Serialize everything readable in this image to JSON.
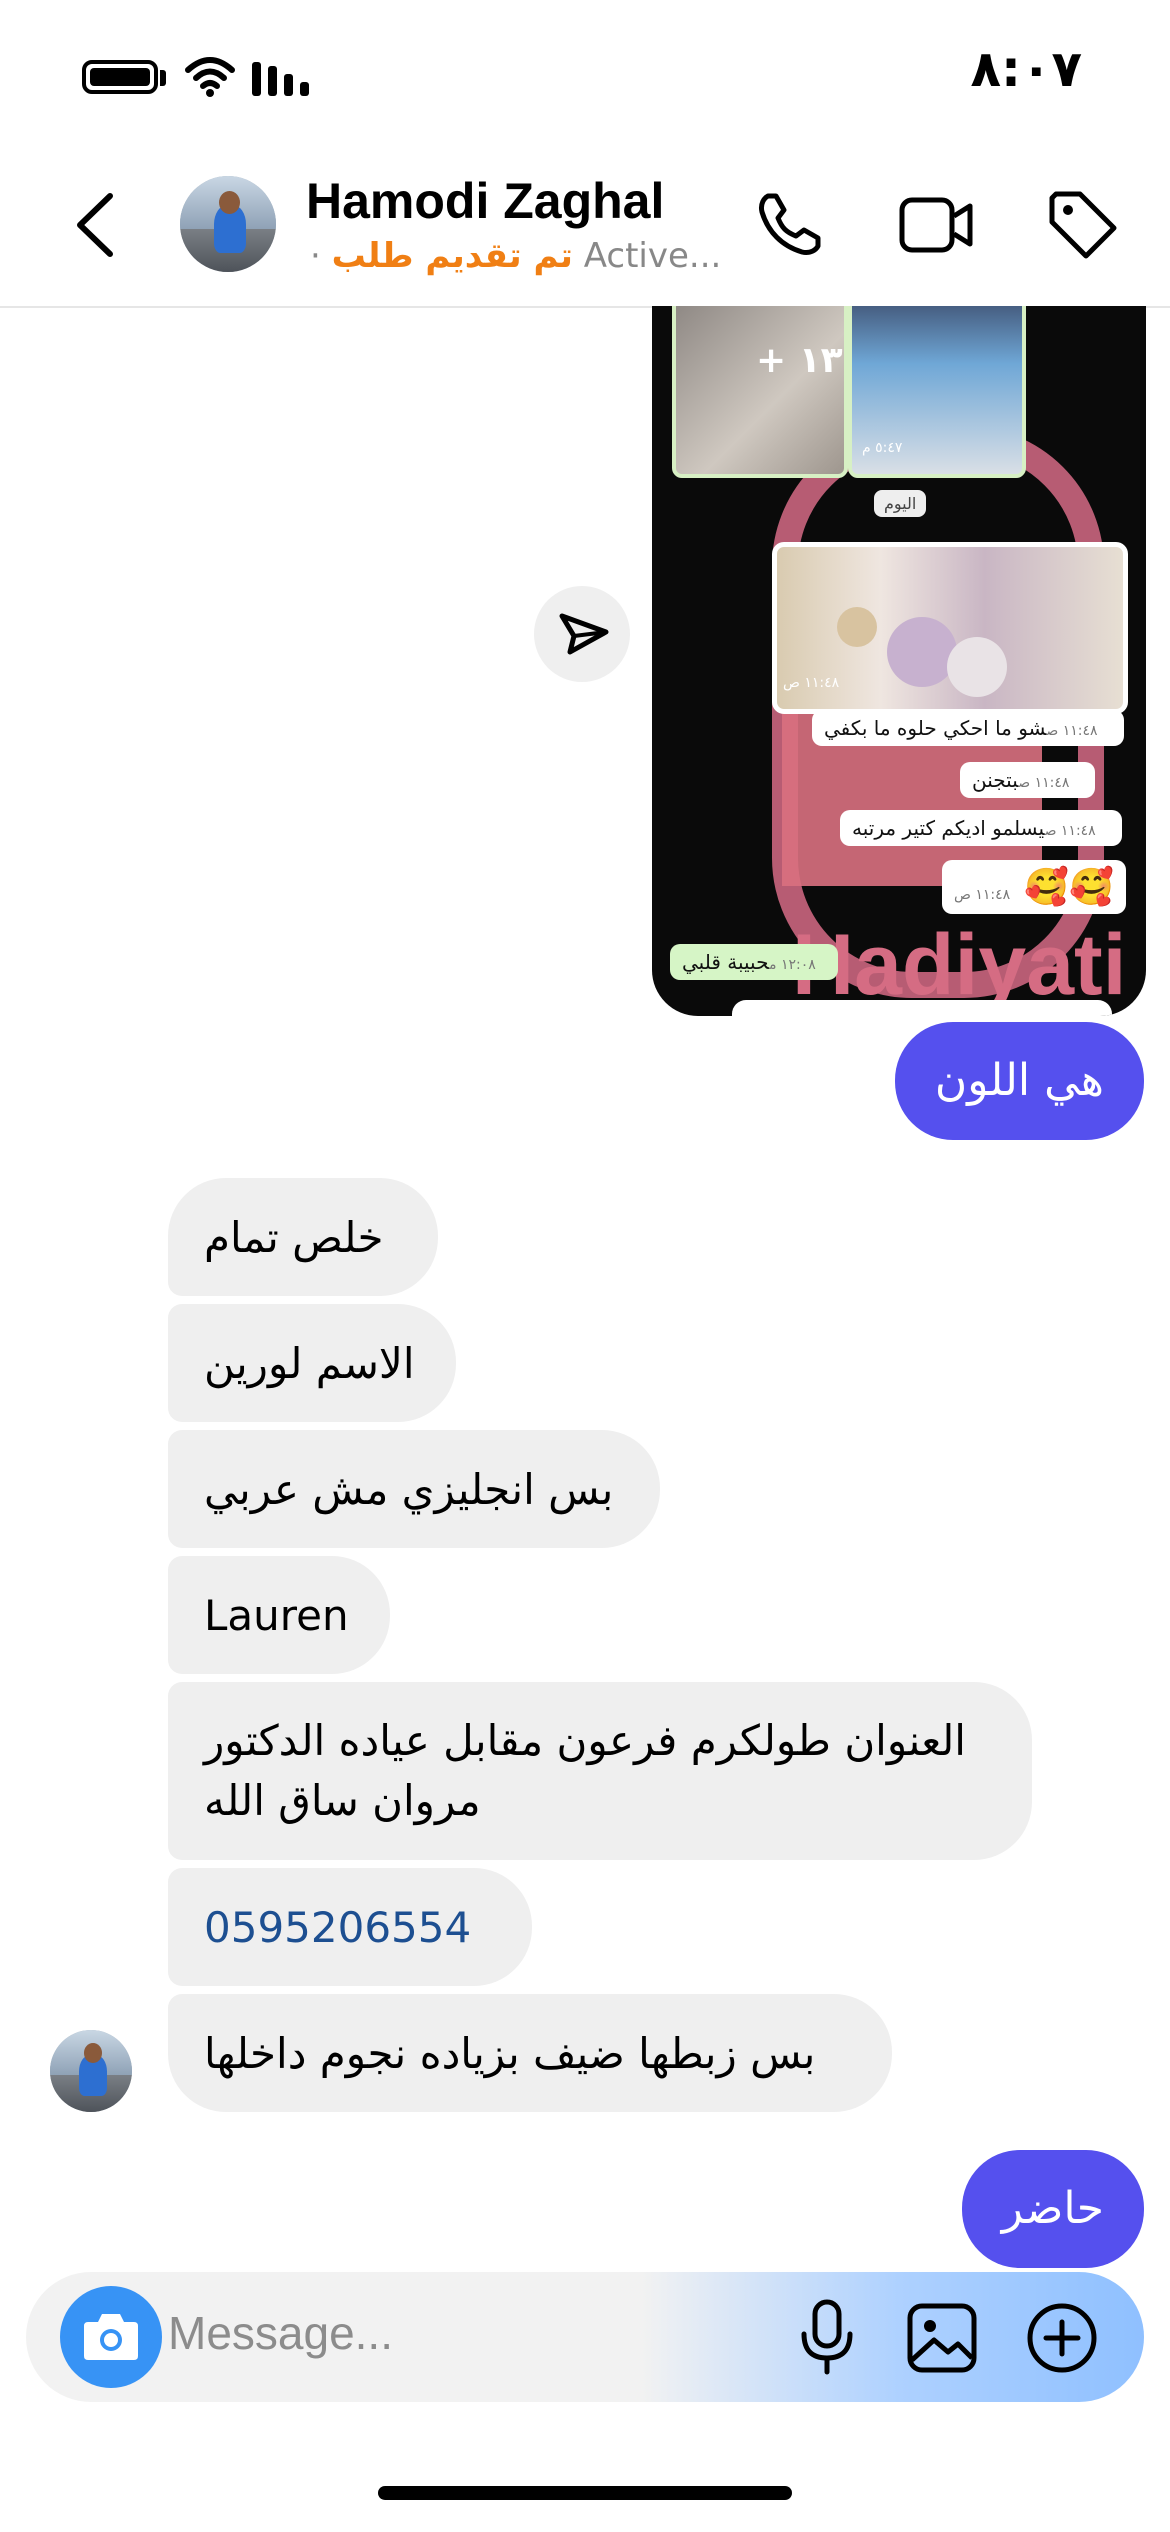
{
  "status_bar": {
    "time": "٨:٠٧"
  },
  "header": {
    "contact_name": "Hamodi Zaghal",
    "status_dot": "·",
    "order_tag": "تم تقديم طلب",
    "activity": "Active..."
  },
  "forwarded_screenshot": {
    "plus_count": "+ ١٣",
    "thumb_time": "٥:٤٧ م",
    "day_label": "اليوم",
    "photo_time": "١١:٤٨ ص",
    "messages": [
      {
        "text": "شو ما احكي حلوه ما بكفي",
        "time": "١١:٤٨ ص"
      },
      {
        "text": "بتجنن",
        "time": "١١:٤٨ ص"
      },
      {
        "text": "يسلمو اديكم كتير مرتبه",
        "time": "١١:٤٨ ص"
      },
      {
        "text": "🥰🥰",
        "time": "١١:٤٨ ص"
      }
    ],
    "green_reply": "حبيبة قلبي",
    "green_time": "١٢:٠٨ م",
    "watermark": "Hadiyati"
  },
  "messages": {
    "out_1": "هي اللون",
    "in": [
      "خلص تمام",
      "الاسم لورين",
      "بس انجليزي مش عربي",
      "Lauren",
      "العنوان طولكرم فرعون مقابل عياده الدكتور",
      "مروان ساق الله",
      "0595206554",
      "بس زبطها ضيف بزياده نجوم داخلها"
    ],
    "out_2": "حاضر"
  },
  "composer": {
    "placeholder": "Message..."
  },
  "colors": {
    "outgoing_bubble": "#5550ee",
    "incoming_bubble": "#efefef",
    "order_tag": "#f07f14",
    "camera_button": "#3793f5",
    "phone_link": "#1d4f91"
  },
  "icons": [
    "back-icon",
    "phone-icon",
    "video-icon",
    "tag-icon",
    "send-icon",
    "camera-icon",
    "mic-icon",
    "gallery-icon",
    "add-icon",
    "wifi-icon",
    "battery-icon",
    "signal-icon"
  ]
}
